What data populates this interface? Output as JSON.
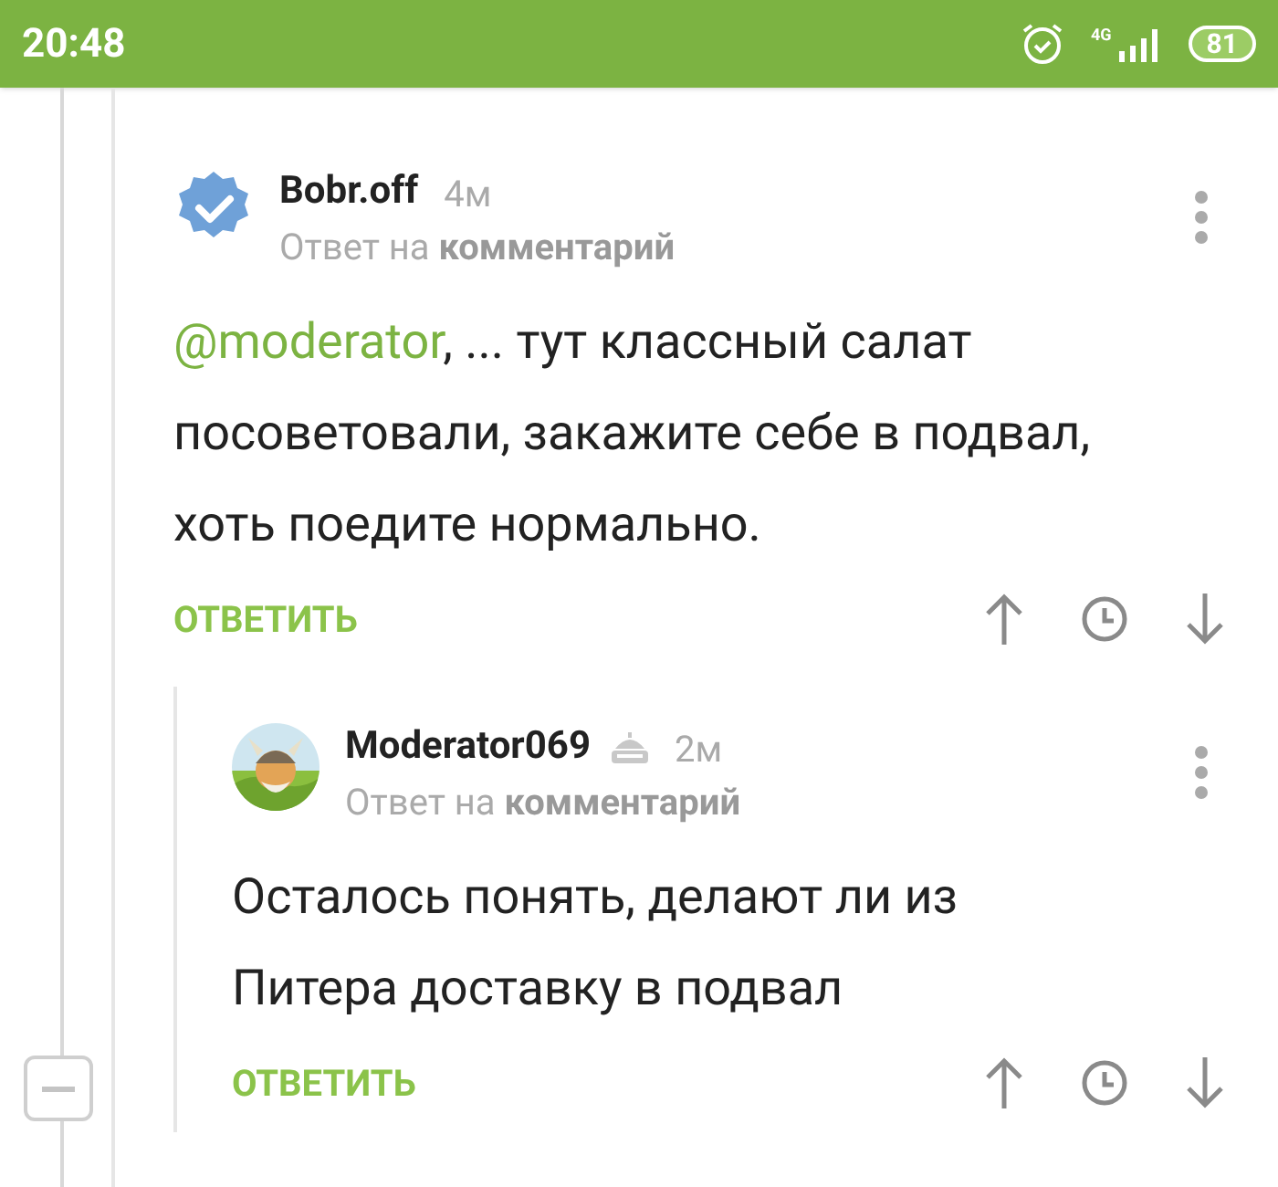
{
  "status_bar": {
    "time": "20:48",
    "network": "4G",
    "battery": "81"
  },
  "comments": [
    {
      "author": "Bobr.off",
      "avatar": {
        "kind": "verified"
      },
      "age": "4м",
      "reply_prefix": "Ответ на",
      "reply_target": "комментарий",
      "mention": "@moderator",
      "text": ", ... тут классный салат посоветовали, закажите себе в подвал, хоть поедите нормально.",
      "reply_label": "ОТВЕТИТЬ",
      "children": [
        {
          "author": "Moderator069",
          "age": "2м",
          "reply_prefix": "Ответ на",
          "reply_target": "комментарий",
          "text": "Осталось понять, делают ли из Питера доставку в подвал",
          "reply_label": "ОТВЕТИТЬ",
          "badge": true,
          "collapse": true
        }
      ]
    }
  ]
}
